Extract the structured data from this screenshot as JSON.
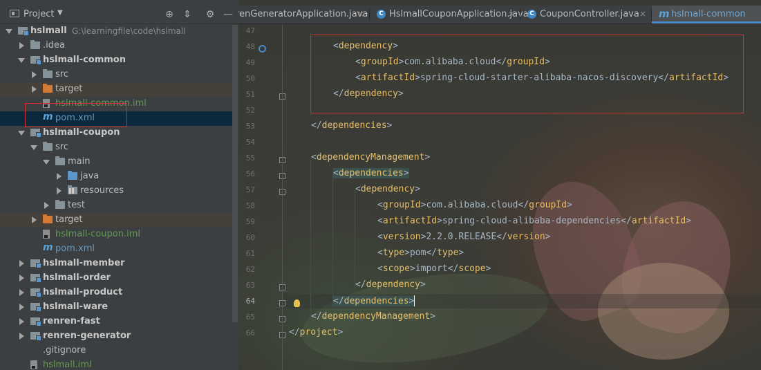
{
  "project_panel": {
    "title": "Project",
    "tree": [
      {
        "label": "hslmall",
        "path": "G:\\learningfile\\code\\hslmall",
        "type": "module",
        "expanded": true,
        "bold": true
      },
      {
        "label": ".idea",
        "type": "folder",
        "expanded": false
      },
      {
        "label": "hslmall-common",
        "type": "module",
        "expanded": true,
        "bold": true
      },
      {
        "label": "src",
        "type": "folder",
        "expanded": false
      },
      {
        "label": "target",
        "type": "folder-excluded",
        "expanded": false
      },
      {
        "label": "hslmall-common.iml",
        "type": "iml"
      },
      {
        "label": "pom.xml",
        "type": "maven",
        "selected": true
      },
      {
        "label": "hslmall-coupon",
        "type": "module",
        "expanded": true,
        "bold": true
      },
      {
        "label": "src",
        "type": "folder",
        "expanded": true
      },
      {
        "label": "main",
        "type": "folder",
        "expanded": true
      },
      {
        "label": "java",
        "type": "source-folder",
        "expanded": false
      },
      {
        "label": "resources",
        "type": "resources-folder",
        "expanded": false
      },
      {
        "label": "test",
        "type": "folder",
        "expanded": false
      },
      {
        "label": "target",
        "type": "folder-excluded",
        "expanded": false
      },
      {
        "label": "hslmall-coupon.iml",
        "type": "iml"
      },
      {
        "label": "pom.xml",
        "type": "maven"
      },
      {
        "label": "hslmall-member",
        "type": "module",
        "expanded": false,
        "bold": true
      },
      {
        "label": "hslmall-order",
        "type": "module",
        "expanded": false,
        "bold": true
      },
      {
        "label": "hslmall-product",
        "type": "module",
        "expanded": false,
        "bold": true
      },
      {
        "label": "hslmall-ware",
        "type": "module",
        "expanded": false,
        "bold": true
      },
      {
        "label": "renren-fast",
        "type": "module",
        "expanded": false,
        "bold": true
      },
      {
        "label": "renren-generator",
        "type": "module",
        "expanded": false,
        "bold": true
      },
      {
        "label": ".gitignore",
        "type": "file"
      },
      {
        "label": "hslmall.iml",
        "type": "iml"
      }
    ]
  },
  "tabs": [
    {
      "label": "renGeneratorApplication.java",
      "icon": "class-icon"
    },
    {
      "label": "HslmallCouponApplication.java",
      "icon": "class-icon"
    },
    {
      "label": "CouponController.java",
      "icon": "class-icon"
    },
    {
      "label": "hslmall-common",
      "icon": "maven-icon",
      "active": true
    }
  ],
  "editor": {
    "line_numbers": [
      "47",
      "48",
      "49",
      "50",
      "51",
      "52",
      "53",
      "54",
      "55",
      "56",
      "57",
      "58",
      "59",
      "60",
      "61",
      "62",
      "63",
      "64",
      "65",
      "66"
    ],
    "current_line": "64",
    "lines": [
      {
        "indent": 2,
        "parts": []
      },
      {
        "indent": 2,
        "parts": [
          [
            "t",
            "<"
          ],
          [
            "g",
            "dependency"
          ],
          [
            "t",
            ">"
          ]
        ]
      },
      {
        "indent": 3,
        "parts": [
          [
            "t",
            "<"
          ],
          [
            "g",
            "groupId"
          ],
          [
            "t",
            ">com.alibaba.cloud</"
          ],
          [
            "g",
            "groupId"
          ],
          [
            "t",
            ">"
          ]
        ]
      },
      {
        "indent": 3,
        "parts": [
          [
            "t",
            "<"
          ],
          [
            "g",
            "artifactId"
          ],
          [
            "t",
            ">spring-cloud-starter-alibaba-nacos-discovery</"
          ],
          [
            "g",
            "artifactId"
          ],
          [
            "t",
            ">"
          ]
        ]
      },
      {
        "indent": 2,
        "parts": [
          [
            "t",
            "</"
          ],
          [
            "g",
            "dependency"
          ],
          [
            "t",
            ">"
          ]
        ]
      },
      {
        "indent": 0,
        "parts": []
      },
      {
        "indent": 1,
        "parts": [
          [
            "t",
            "</"
          ],
          [
            "g",
            "dependencies"
          ],
          [
            "t",
            ">"
          ]
        ]
      },
      {
        "indent": 0,
        "parts": []
      },
      {
        "indent": 1,
        "parts": [
          [
            "t",
            "<"
          ],
          [
            "g",
            "dependencyManagement"
          ],
          [
            "t",
            ">"
          ]
        ]
      },
      {
        "indent": 2,
        "parts": [
          [
            "t",
            "<"
          ],
          [
            "g",
            "dependencies"
          ],
          [
            "t",
            ">"
          ]
        ],
        "highlight": true
      },
      {
        "indent": 3,
        "parts": [
          [
            "t",
            "<"
          ],
          [
            "g",
            "dependency"
          ],
          [
            "t",
            ">"
          ]
        ]
      },
      {
        "indent": 4,
        "parts": [
          [
            "t",
            "<"
          ],
          [
            "g",
            "groupId"
          ],
          [
            "t",
            ">com.alibaba.cloud</"
          ],
          [
            "g",
            "groupId"
          ],
          [
            "t",
            ">"
          ]
        ]
      },
      {
        "indent": 4,
        "parts": [
          [
            "t",
            "<"
          ],
          [
            "g",
            "artifactId"
          ],
          [
            "t",
            ">spring-cloud-alibaba-dependencies</"
          ],
          [
            "g",
            "artifactId"
          ],
          [
            "t",
            ">"
          ]
        ]
      },
      {
        "indent": 4,
        "parts": [
          [
            "t",
            "<"
          ],
          [
            "g",
            "version"
          ],
          [
            "t",
            ">2.2.0.RELEASE</"
          ],
          [
            "g",
            "version"
          ],
          [
            "t",
            ">"
          ]
        ]
      },
      {
        "indent": 4,
        "parts": [
          [
            "t",
            "<"
          ],
          [
            "g",
            "type"
          ],
          [
            "t",
            ">pom</"
          ],
          [
            "g",
            "type"
          ],
          [
            "t",
            ">"
          ]
        ]
      },
      {
        "indent": 4,
        "parts": [
          [
            "t",
            "<"
          ],
          [
            "g",
            "scope"
          ],
          [
            "t",
            ">import</"
          ],
          [
            "g",
            "scope"
          ],
          [
            "t",
            ">"
          ]
        ]
      },
      {
        "indent": 3,
        "parts": [
          [
            "t",
            "</"
          ],
          [
            "g",
            "dependency"
          ],
          [
            "t",
            ">"
          ]
        ]
      },
      {
        "indent": 2,
        "parts": [
          [
            "t",
            "</"
          ],
          [
            "g",
            "dependencies"
          ],
          [
            "t",
            ">"
          ]
        ],
        "highlight": true,
        "caret": true
      },
      {
        "indent": 1,
        "parts": [
          [
            "t",
            "</"
          ],
          [
            "g",
            "dependencyManagement"
          ],
          [
            "t",
            ">"
          ]
        ]
      },
      {
        "indent": 0,
        "parts": [
          [
            "t",
            "</"
          ],
          [
            "g",
            "project"
          ],
          [
            "t",
            ">"
          ]
        ]
      }
    ]
  }
}
